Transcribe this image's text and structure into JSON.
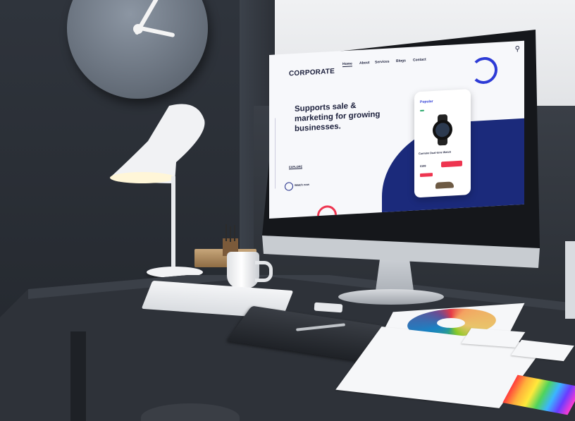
{
  "screen": {
    "logo": "CORPORATE",
    "nav": [
      "Home",
      "About",
      "Services",
      "Blogs",
      "Contact"
    ],
    "hero_title": "Supports sale & marketing for growing businesses.",
    "cta": "EXPLORE",
    "play_label": "Watch now",
    "phone": {
      "title": "Popular",
      "product": "Carmine Dual-tone Watch",
      "price": "$199"
    }
  },
  "colors": {
    "navy": "#1b2a7b",
    "accent_red": "#ee3550",
    "accent_blue": "#2d3bd6"
  }
}
